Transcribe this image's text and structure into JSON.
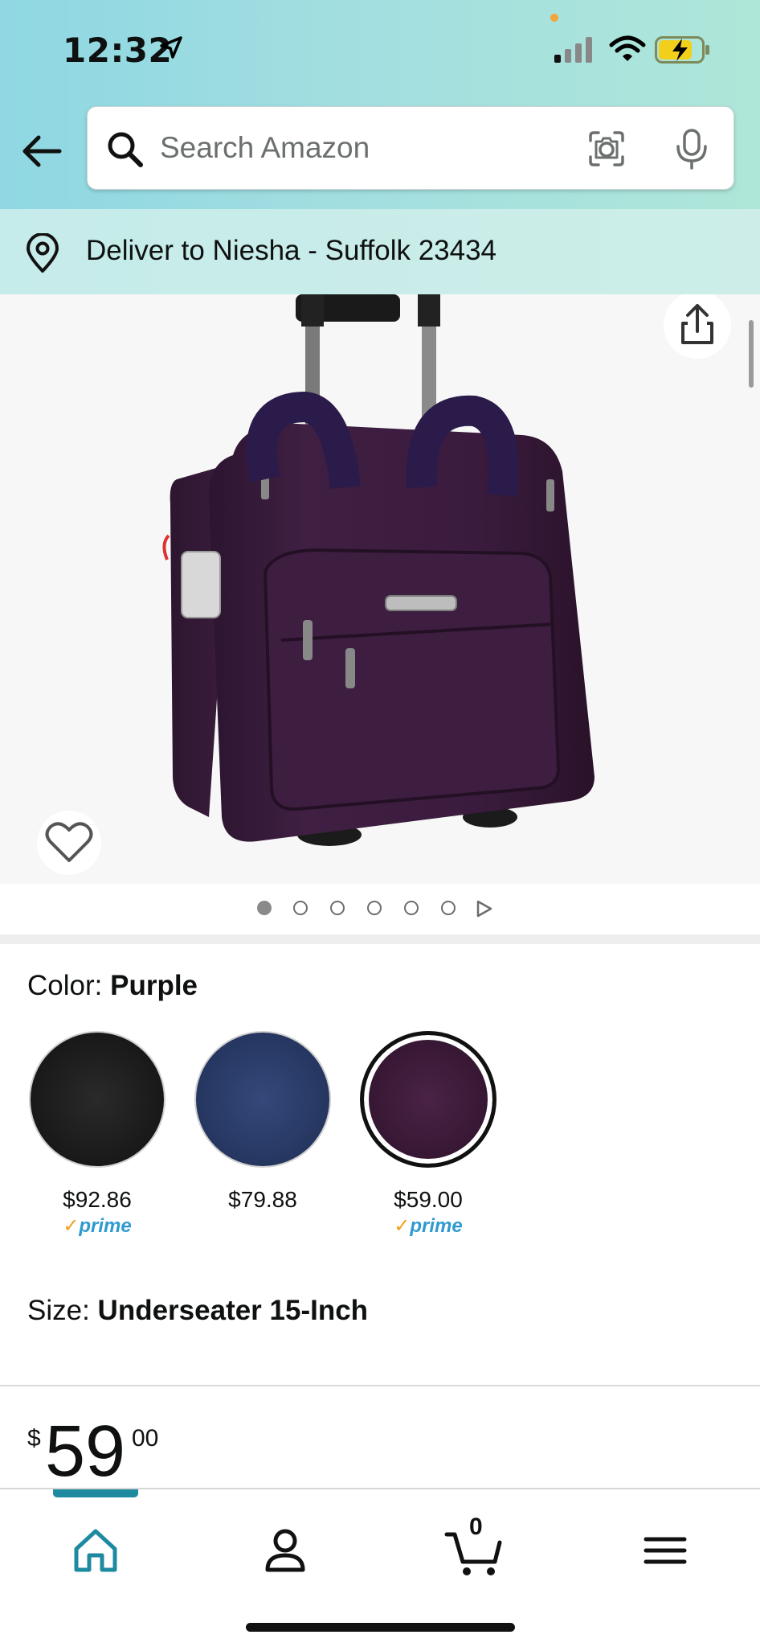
{
  "status_bar": {
    "time": "12:32"
  },
  "search": {
    "placeholder": "Search Amazon"
  },
  "delivery": {
    "text": "Deliver to Niesha - Suffolk 23434"
  },
  "gallery": {
    "image_count": 6,
    "active_index": 0
  },
  "color": {
    "label": "Color: ",
    "selected": "Purple",
    "options": [
      {
        "name": "Black",
        "price": "$92.86",
        "prime": true,
        "swatch": "#1e1e1e"
      },
      {
        "name": "Navy",
        "price": "$79.88",
        "prime": false,
        "swatch": "#2a3b63"
      },
      {
        "name": "Purple",
        "price": "$59.00",
        "prime": true,
        "swatch": "#3a1a36"
      }
    ]
  },
  "prime_badge": {
    "check": "✓",
    "text": "prime"
  },
  "size": {
    "label": "Size: ",
    "selected": "Underseater 15-Inch"
  },
  "price": {
    "currency": "$",
    "whole": "59",
    "fraction": "00"
  },
  "nav": {
    "cart_count": "0"
  },
  "colors": {
    "accent": "#1e8aa0",
    "prime_blue": "#2f9ad1",
    "prime_check": "#f0a020"
  }
}
